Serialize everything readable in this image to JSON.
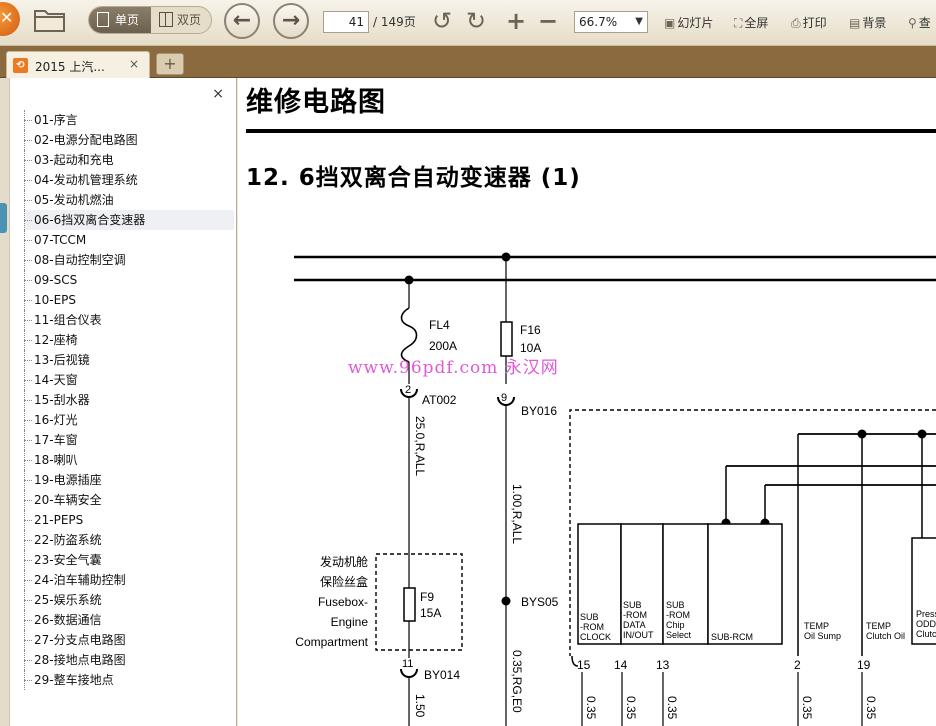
{
  "toolbar": {
    "single_page": "单页",
    "double_page": "双页",
    "current_page": "41",
    "total_pages": "/ 149页",
    "zoom": "66.7%",
    "slideshow": "幻灯片",
    "fullscreen": "全屏",
    "print": "打印",
    "background": "背景",
    "find": "查"
  },
  "tab": {
    "label": "2015 上汽...",
    "close": "×",
    "new_tab": "+"
  },
  "bookmarks": {
    "close": "×",
    "items": [
      "01-序言",
      "02-电源分配电路图",
      "03-起动和充电",
      "04-发动机管理系统",
      "05-发动机燃油",
      "06-6挡双离合变速器",
      "07-TCCM",
      "08-自动控制空调",
      "09-SCS",
      "10-EPS",
      "11-组合仪表",
      "12-座椅",
      "13-后视镜",
      "14-天窗",
      "15-刮水器",
      "16-灯光",
      "17-车窗",
      "18-喇叭",
      "19-电源插座",
      "20-车辆安全",
      "21-PEPS",
      "22-防盗系统",
      "23-安全气囊",
      "24-泊车辅助控制",
      "25-娱乐系统",
      "26-数据通信",
      "27-分支点电路图",
      "28-接地点电路图",
      "29-整车接地点"
    ],
    "selected_index": 5
  },
  "document": {
    "title": "维修电路图",
    "subtitle": "12. 6挡双离合自动变速器 (1)",
    "watermark": "www.96pdf.com 永汉网",
    "diagram": {
      "fl4": "FL4",
      "fl4_amp": "200A",
      "f16": "F16",
      "f16_amp": "10A",
      "at002_pin": "2",
      "at002": "AT002",
      "by016_pin": "9",
      "by016": "BY016",
      "wire_1": "25.0,R,ALL",
      "wire_2": "1.00,R,ALL",
      "wire_3": "0.35,RG,E0",
      "wire_4": "1.50",
      "bys05": "BYS05",
      "fusebox_cn_1": "发动机舱",
      "fusebox_cn_2": "保险丝盒",
      "fusebox_en_1": "Fusebox-",
      "fusebox_en_2": "Engine",
      "fusebox_en_3": "Compartment",
      "f9": "F9",
      "f9_amp": "15A",
      "by014_pin": "11",
      "by014": "BY014",
      "modules": [
        {
          "l1": "SUB",
          "l2": "-ROM",
          "l3": "CLOCK"
        },
        {
          "l1": "SUB",
          "l2": "-ROM",
          "l3": "DATA",
          "l4": "IN/OUT"
        },
        {
          "l1": "SUB",
          "l2": "-ROM",
          "l3": "Chip",
          "l4": "Select"
        },
        {
          "l1": "SUB-RCM"
        },
        {
          "l1": "TEMP",
          "l2": "Oil Sump"
        },
        {
          "l1": "TEMP",
          "l2": "Clutch Oil"
        },
        {
          "l1": "Press",
          "l2": "ODD",
          "l3": "Clutc"
        }
      ],
      "pins": [
        "15",
        "14",
        "13",
        "2",
        "19"
      ],
      "bottom_wire": "0.35"
    }
  }
}
